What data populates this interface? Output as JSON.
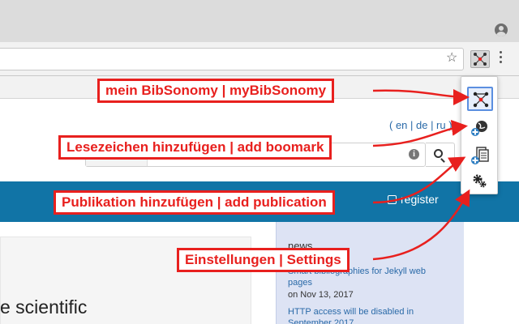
{
  "page": {
    "languages": "( en | de | ru )",
    "register_label": "register",
    "headline": "e scientific",
    "news": {
      "title": "news",
      "link1": "Smart bibliographies for Jekyll web pages",
      "date1": "on Nov 13, 2017",
      "link2": "HTTP access will be disabled in September 2017"
    }
  },
  "icons": {
    "profile": "profile-icon",
    "star": "star-icon",
    "extension": "bibsonomy-extension-icon",
    "menu": "menu-icon",
    "info": "info-icon",
    "search": "search-icon",
    "register": "edit-icon"
  },
  "glyphs": {
    "star": "☆",
    "info": "i"
  },
  "popup_items": [
    {
      "name": "my-bibsonomy",
      "icon": "network-icon"
    },
    {
      "name": "add-bookmark",
      "icon": "globe-plus-icon"
    },
    {
      "name": "add-publication",
      "icon": "document-plus-icon"
    },
    {
      "name": "settings",
      "icon": "gears-icon"
    }
  ],
  "callouts": {
    "my_bibsonomy": "mein BibSonomy | myBibSonomy",
    "add_bookmark": "Lesezeichen hinzufügen | add boomark",
    "add_publication": "Publikation hinzufügen | add publication",
    "settings": "Einstellungen | Settings"
  },
  "colors": {
    "callout": "#e8201e",
    "navbar": "#1174a6",
    "news_bg": "#dde3f4",
    "link": "#2a6aa8"
  }
}
